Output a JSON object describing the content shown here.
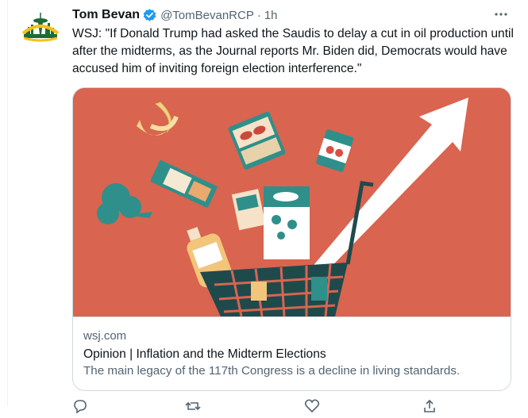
{
  "tweet": {
    "display_name": "Tom Bevan",
    "handle": "@TomBevanRCP",
    "separator": "·",
    "time": "1h",
    "verified": true,
    "text": "WSJ: \"If Donald Trump had asked the Saudis to delay a cut in oil production until after the midterms, as the Journal reports Mr. Biden did, Democrats would have accused him of inviting foreign election interference.\"",
    "avatar_icon": "seattle-supersonics-logo",
    "more_icon": "more-icon"
  },
  "card": {
    "domain": "wsj.com",
    "title": "Opinion | Inflation and the Midterm Elections",
    "description": "The main legacy of the 117th Congress is a decline in living standards.",
    "image_background": "#d9644f"
  },
  "colors": {
    "text_primary": "#0f1419",
    "text_secondary": "#536471",
    "verified_blue": "#1d9bf0",
    "border": "#cfd9de"
  },
  "actions": [
    "reply-icon",
    "retweet-icon",
    "like-icon",
    "share-icon"
  ]
}
